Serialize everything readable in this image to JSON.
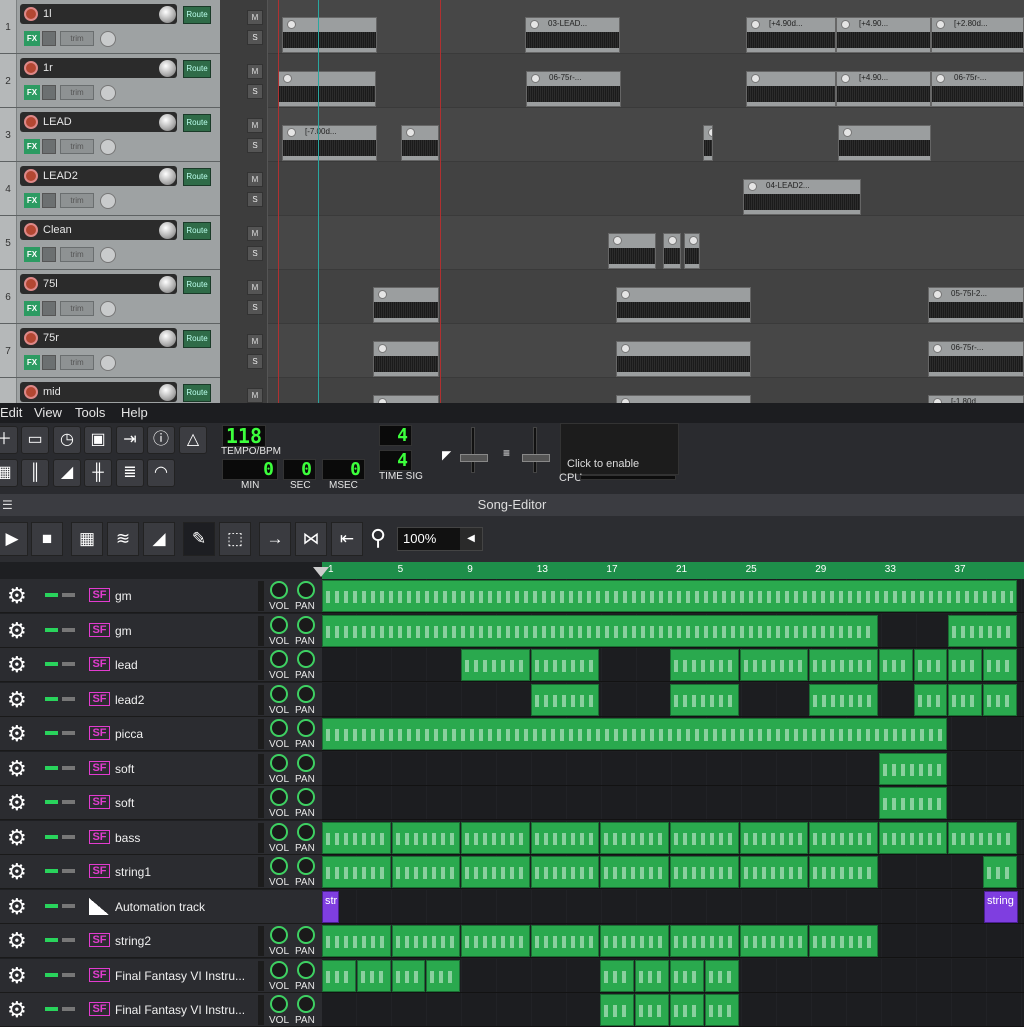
{
  "reaper": {
    "tracks": [
      {
        "num": "1",
        "name": "1l",
        "route": "Route",
        "fx": "FX",
        "trim": "trim"
      },
      {
        "num": "2",
        "name": "1r",
        "route": "Route",
        "fx": "FX",
        "trim": "trim"
      },
      {
        "num": "3",
        "name": "LEAD",
        "route": "Route",
        "fx": "FX",
        "trim": "trim"
      },
      {
        "num": "4",
        "name": "LEAD2",
        "route": "Route",
        "fx": "FX",
        "trim": "trim"
      },
      {
        "num": "5",
        "name": "Clean",
        "route": "Route",
        "fx": "FX",
        "trim": "trim"
      },
      {
        "num": "6",
        "name": "75l",
        "route": "Route",
        "fx": "FX",
        "trim": "trim"
      },
      {
        "num": "7",
        "name": "75r",
        "route": "Route",
        "fx": "FX",
        "trim": "trim"
      },
      {
        "num": "",
        "name": "mid",
        "route": "Route",
        "fx": "FX",
        "trim": "trim"
      }
    ],
    "mute_label": "M",
    "solo_label": "S",
    "clip_labels": {
      "t1a": "03-LEAD...",
      "t1b": "[+4.90d...",
      "t1c": "[+4.90...",
      "t1d": "[+2.80d...",
      "t2a": "06-75r-...",
      "t2b": "[+4.90...",
      "t2c": "06-75r-...",
      "t3a": "[-7.00d...",
      "t4a": "04-LEAD2...",
      "t6a": "05-75l-2...",
      "t7a": "06-75r-...",
      "t8a": "[-1.80d..."
    }
  },
  "menu": {
    "items": [
      "Edit",
      "View",
      "Tools",
      "Help"
    ]
  },
  "transport": {
    "tempo": "118",
    "tempo_label": "TEMPO/BPM",
    "min": "0",
    "min_label": "MIN",
    "sec": "0",
    "sec_label": "SEC",
    "msec": "0",
    "msec_label": "MSEC",
    "ts_num": "4",
    "ts_den": "4",
    "ts_label": "TIME SIG",
    "cpu_hint": "Click to enable",
    "cpu_label": "CPU"
  },
  "song_editor": {
    "title": "Song-Editor",
    "zoom": "100%",
    "ruler": [
      "1",
      "5",
      "9",
      "13",
      "17",
      "21",
      "25",
      "29",
      "33",
      "37"
    ],
    "vol_label": "VOL",
    "pan_label": "PAN",
    "tracks": [
      {
        "name": "gm",
        "type": "inst"
      },
      {
        "name": "gm",
        "type": "inst"
      },
      {
        "name": "lead",
        "type": "inst"
      },
      {
        "name": "lead2",
        "type": "inst"
      },
      {
        "name": "picca",
        "type": "inst"
      },
      {
        "name": "soft",
        "type": "inst"
      },
      {
        "name": "soft",
        "type": "inst"
      },
      {
        "name": "bass",
        "type": "inst"
      },
      {
        "name": "string1",
        "type": "inst"
      },
      {
        "name": "Automation track",
        "type": "auto",
        "clips": [
          "str",
          "string"
        ]
      },
      {
        "name": "string2",
        "type": "inst"
      },
      {
        "name": "Final Fantasy VI Instru...",
        "type": "inst"
      },
      {
        "name": "Final Fantasy VI Instru...",
        "type": "inst"
      }
    ]
  },
  "colors": {
    "pattern": "#2aa94e",
    "automation": "#7f3ee0",
    "lcd": "#3cff3c"
  }
}
